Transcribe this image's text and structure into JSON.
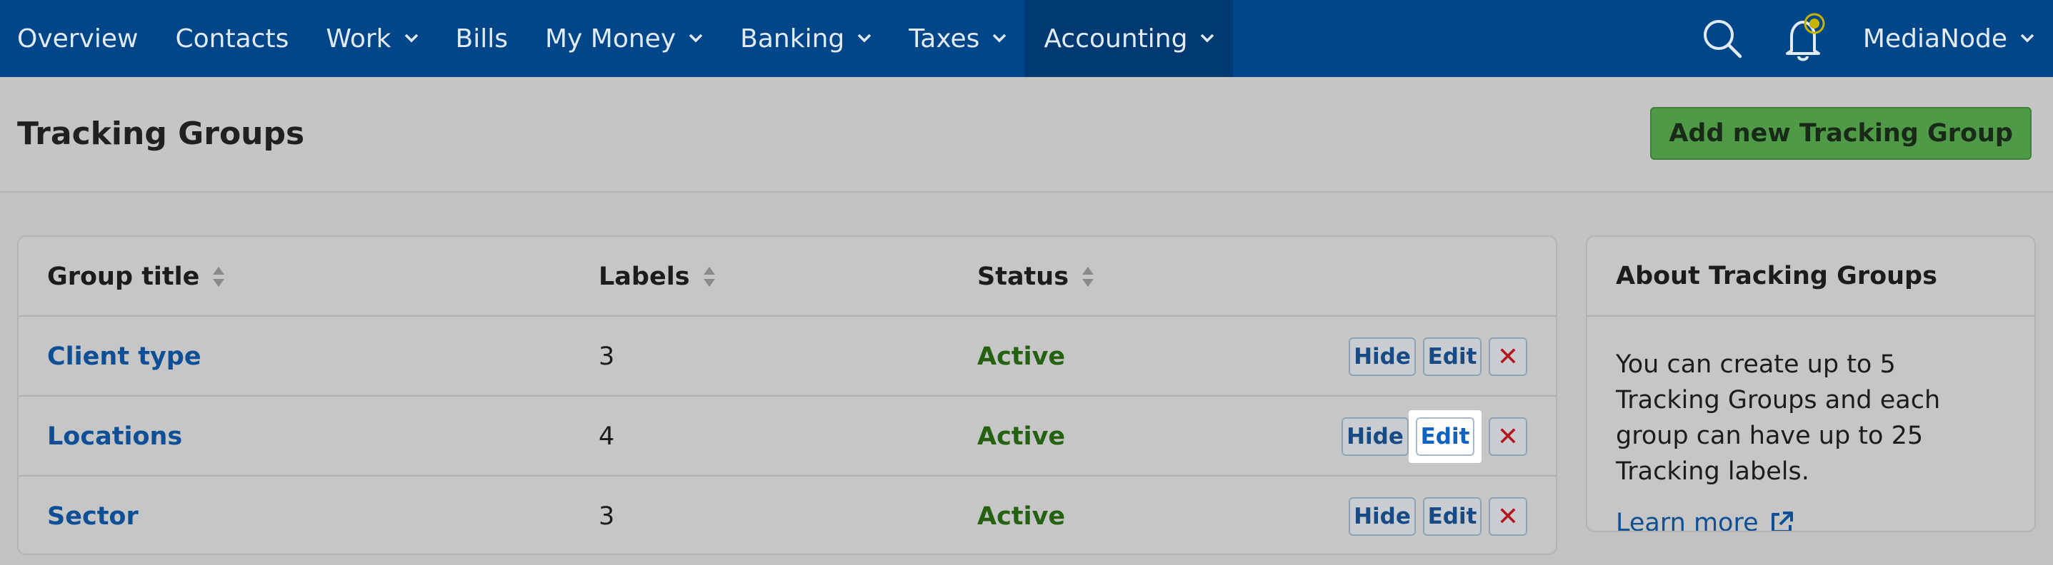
{
  "nav": {
    "items": [
      {
        "label": "Overview",
        "has_menu": false
      },
      {
        "label": "Contacts",
        "has_menu": false
      },
      {
        "label": "Work",
        "has_menu": true
      },
      {
        "label": "Bills",
        "has_menu": false
      },
      {
        "label": "My Money",
        "has_menu": true
      },
      {
        "label": "Banking",
        "has_menu": true
      },
      {
        "label": "Taxes",
        "has_menu": true
      },
      {
        "label": "Accounting",
        "has_menu": true,
        "active": true
      }
    ],
    "org_name": "MediaNode",
    "icons": [
      "search-icon",
      "bell-icon",
      "chevron-down-icon"
    ]
  },
  "header": {
    "title": "Tracking Groups",
    "add_button": "Add new Tracking Group"
  },
  "table": {
    "columns": [
      "Group title",
      "Labels",
      "Status"
    ],
    "rows": [
      {
        "title": "Client type",
        "labels": "3",
        "status": "Active"
      },
      {
        "title": "Locations",
        "labels": "4",
        "status": "Active"
      },
      {
        "title": "Sector",
        "labels": "3",
        "status": "Active"
      }
    ],
    "actions": {
      "hide": "Hide",
      "edit": "Edit",
      "delete": "✕"
    }
  },
  "about": {
    "title": "About Tracking Groups",
    "body": "You can create up to 5 Tracking Groups and each group can have up to 25 Tracking labels.",
    "learn_more": "Learn more"
  },
  "colors": {
    "nav_bg": "#004689",
    "nav_active_bg": "#003a72",
    "accent_green": "#4e9a47",
    "link_blue": "#0f4f95",
    "status_green": "#246212",
    "delete_red": "#b5161c",
    "notification_dot": "#c8b400"
  }
}
